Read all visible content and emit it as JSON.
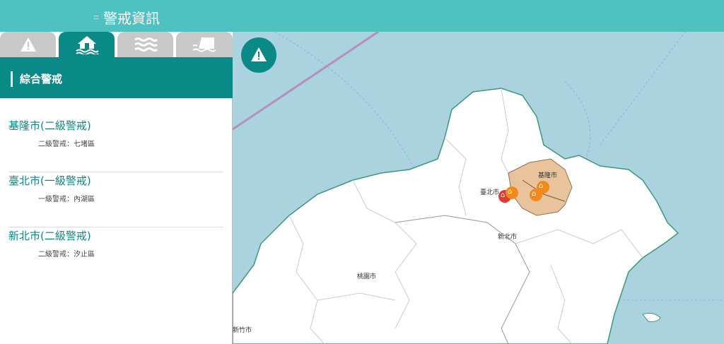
{
  "header": {
    "title": "警戒資訊",
    "dots": ":::"
  },
  "tabs": [
    {
      "name": "warning-tab",
      "icon": "warning-icon",
      "active": false
    },
    {
      "name": "flood-house-tab",
      "icon": "flood-house-icon",
      "active": true
    },
    {
      "name": "waves-tab",
      "icon": "waves-icon",
      "active": false
    },
    {
      "name": "dam-tab",
      "icon": "dam-icon",
      "active": false
    }
  ],
  "section": {
    "title": "綜合警戒"
  },
  "alerts": [
    {
      "city": "基隆市(二級警戒)",
      "detail": "二級警戒：七堵區"
    },
    {
      "city": "臺北市(一級警戒)",
      "detail": "一級警戒：內湖區"
    },
    {
      "city": "新北市(二級警戒)",
      "detail": "二級警戒：汐止區"
    }
  ],
  "map": {
    "labels": {
      "keelung": "基隆市",
      "taipei": "臺北市",
      "new_taipei": "新北市",
      "taoyuan": "桃園市",
      "hsinchu": "新竹市"
    },
    "colors": {
      "sea": "#aad3df",
      "land": "#ffffff",
      "alert_area": "#e6b98a",
      "marker_red": "#e23a2e",
      "marker_orange": "#f08a1e"
    }
  }
}
